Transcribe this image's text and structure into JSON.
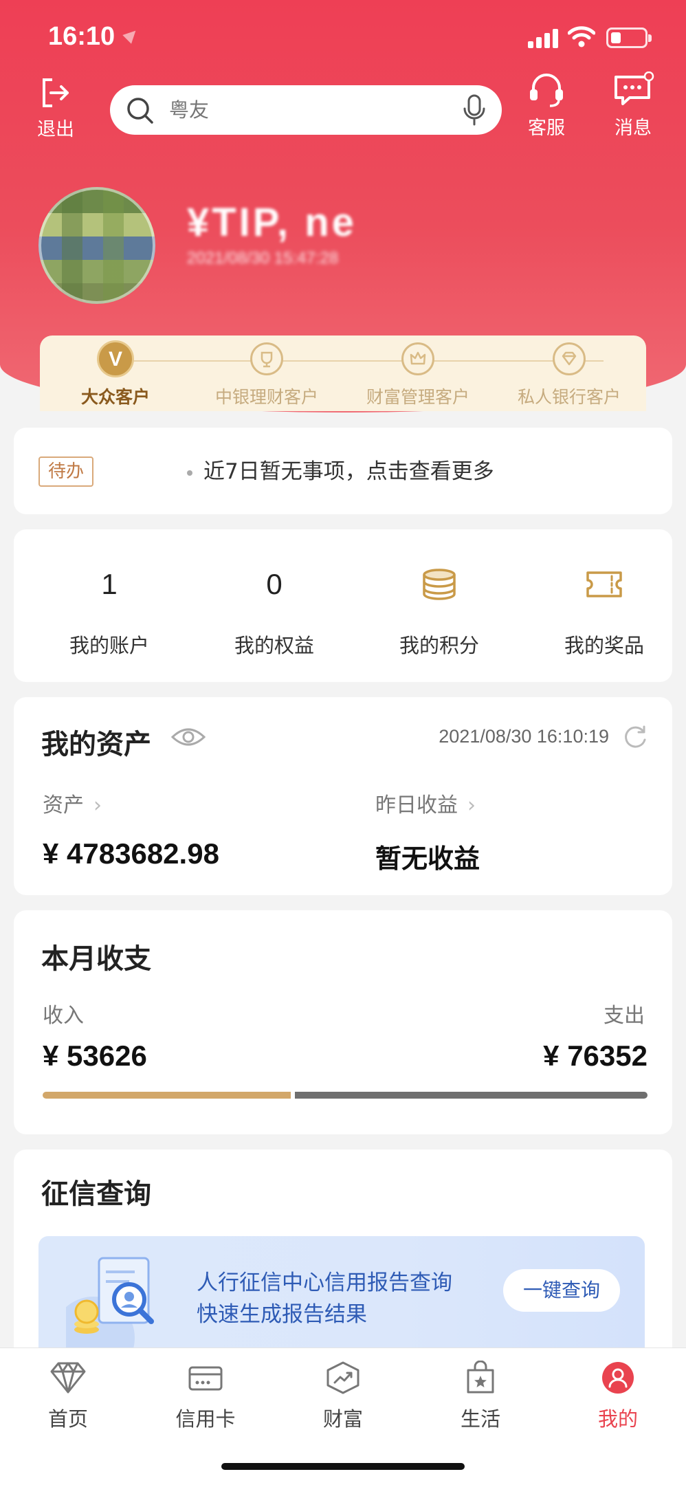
{
  "status_bar": {
    "time": "16:10"
  },
  "header": {
    "exit_label": "退出",
    "search_placeholder": "粤友",
    "service_label": "客服",
    "message_label": "消息"
  },
  "user": {
    "name": "¥TIP, ne",
    "login_time": "2021/08/30 15:47:28"
  },
  "tiers": [
    {
      "label": "大众客户",
      "active": true
    },
    {
      "label": "中银理财客户",
      "active": false
    },
    {
      "label": "财富管理客户",
      "active": false
    },
    {
      "label": "私人银行客户",
      "active": false
    }
  ],
  "todo": {
    "badge": "待办",
    "text": "近7日暂无事项，点击查看更多"
  },
  "stats": [
    {
      "value": "1",
      "label": "我的账户"
    },
    {
      "value": "0",
      "label": "我的权益"
    },
    {
      "icon": "coins-icon",
      "label": "我的积分"
    },
    {
      "icon": "ticket-icon",
      "label": "我的奖品"
    }
  ],
  "assets": {
    "title": "我的资产",
    "timestamp": "2021/08/30 16:10:19",
    "asset_label": "资产",
    "asset_value": "¥ 4783682.98",
    "yesterday_label": "昨日收益",
    "yesterday_value": "暂无收益"
  },
  "monthly": {
    "title": "本月收支",
    "income_label": "收入",
    "income_value": "¥ 53626",
    "income_amount": 53626,
    "expense_label": "支出",
    "expense_value": "¥ 76352",
    "expense_amount": 76352,
    "income_color": "#d2a76a",
    "expense_color": "#6f6f6f"
  },
  "credit": {
    "title": "征信查询",
    "line1": "人行征信中心信用报告查询",
    "line2": "快速生成报告结果",
    "button": "一键查询"
  },
  "tabs": [
    {
      "label": "首页",
      "icon": "diamond-icon",
      "active": false
    },
    {
      "label": "信用卡",
      "icon": "credit-card-icon",
      "active": false
    },
    {
      "label": "财富",
      "icon": "wealth-chart-icon",
      "active": false
    },
    {
      "label": "生活",
      "icon": "shopping-bag-icon",
      "active": false
    },
    {
      "label": "我的",
      "icon": "user-icon",
      "active": true
    }
  ],
  "colors": {
    "brand": "#ee3f55",
    "gold": "#c99a48",
    "link_blue": "#2e5bb5"
  }
}
